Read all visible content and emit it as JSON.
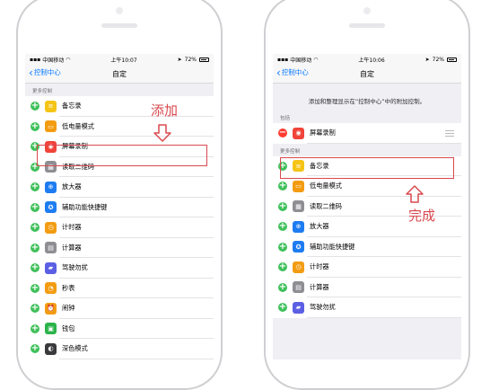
{
  "left_phone": {
    "status": {
      "carrier": "中国移动",
      "time": "上午10:07",
      "battery": "72%"
    },
    "nav": {
      "back_label": "控制中心",
      "title": "自定"
    },
    "section_more": "更多控制",
    "items": [
      {
        "label": "备忘录",
        "icon": "notes-icon",
        "color": "#f5c417",
        "glyph": "≡"
      },
      {
        "label": "低电量模式",
        "icon": "battery-icon",
        "color": "#f39c12",
        "glyph": "▭"
      },
      {
        "label": "屏幕录制",
        "icon": "record-icon",
        "color": "#f0433a",
        "glyph": "◉"
      },
      {
        "label": "读取二维码",
        "icon": "qrcode-icon",
        "color": "#8e8e93",
        "glyph": "▦"
      },
      {
        "label": "放大器",
        "icon": "magnifier-icon",
        "color": "#1e7cf2",
        "glyph": "⊕"
      },
      {
        "label": "辅助功能快捷键",
        "icon": "accessibility-icon",
        "color": "#1e7cf2",
        "glyph": "✪"
      },
      {
        "label": "计时器",
        "icon": "timer-icon",
        "color": "#f39c12",
        "glyph": "◷"
      },
      {
        "label": "计算器",
        "icon": "calculator-icon",
        "color": "#8e8e93",
        "glyph": "▤"
      },
      {
        "label": "驾驶勿扰",
        "icon": "car-icon",
        "color": "#5b5fe3",
        "glyph": "▰"
      },
      {
        "label": "秒表",
        "icon": "stopwatch-icon",
        "color": "#f39c12",
        "glyph": "◔"
      },
      {
        "label": "闹钟",
        "icon": "alarm-icon",
        "color": "#f39c12",
        "glyph": "⏰"
      },
      {
        "label": "钱包",
        "icon": "wallet-icon",
        "color": "#2bb34a",
        "glyph": "▣"
      },
      {
        "label": "深色模式",
        "icon": "darkmode-icon",
        "color": "#3a3a3c",
        "glyph": "◐"
      }
    ]
  },
  "right_phone": {
    "status": {
      "carrier": "中国移动",
      "time": "上午10:06",
      "battery": "72%"
    },
    "nav": {
      "back_label": "控制中心",
      "title": "自定"
    },
    "description": "添加和整理显示在“控制中心”中的附加控制。",
    "section_include": "包括",
    "included": [
      {
        "label": "屏幕录制",
        "icon": "record-icon",
        "color": "#f0433a",
        "glyph": "◉"
      }
    ],
    "section_more": "更多控制",
    "items": [
      {
        "label": "备忘录",
        "icon": "notes-icon",
        "color": "#f5c417",
        "glyph": "≡"
      },
      {
        "label": "低电量模式",
        "icon": "battery-icon",
        "color": "#f39c12",
        "glyph": "▭"
      },
      {
        "label": "读取二维码",
        "icon": "qrcode-icon",
        "color": "#8e8e93",
        "glyph": "▦"
      },
      {
        "label": "放大器",
        "icon": "magnifier-icon",
        "color": "#1e7cf2",
        "glyph": "⊕"
      },
      {
        "label": "辅助功能快捷键",
        "icon": "accessibility-icon",
        "color": "#1e7cf2",
        "glyph": "✪"
      },
      {
        "label": "计时器",
        "icon": "timer-icon",
        "color": "#f39c12",
        "glyph": "◷"
      },
      {
        "label": "计算器",
        "icon": "calculator-icon",
        "color": "#8e8e93",
        "glyph": "▤"
      },
      {
        "label": "驾驶勿扰",
        "icon": "car-icon",
        "color": "#5b5fe3",
        "glyph": "▰"
      }
    ]
  },
  "annotations": {
    "add": "添加",
    "done": "完成",
    "accent": "#d9484e"
  }
}
